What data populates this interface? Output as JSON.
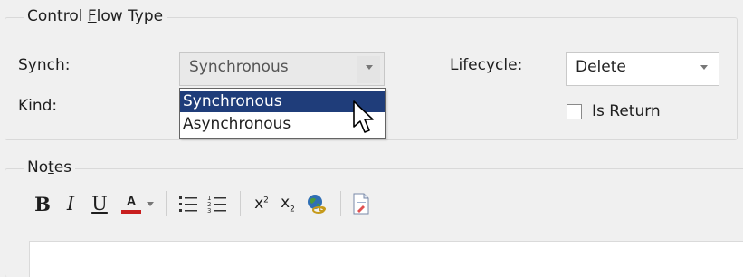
{
  "control_flow_group": {
    "legend_pre": "Control ",
    "legend_mnemonic": "F",
    "legend_post": "low Type",
    "synch_label": "Synch:",
    "synch_value": "Synchronous",
    "kind_label": "Kind:",
    "lifecycle_label": "Lifecycle:",
    "lifecycle_value": "Delete",
    "is_return_label": "Is Return",
    "synch_options": [
      "Synchronous",
      "Asynchronous"
    ],
    "synch_selected_index": 0
  },
  "notes_group": {
    "legend_pre": "No",
    "legend_mnemonic": "t",
    "legend_post": "es"
  },
  "toolbar": {
    "bold_icon": "B",
    "italic_icon": "I",
    "underline_icon": "U",
    "font_color_icon": "A",
    "superscript_base": "x",
    "superscript_exp": "2",
    "subscript_base": "x",
    "subscript_exp": "2"
  },
  "colors": {
    "selection": "#1f3d7a",
    "font_color_bar": "#c81e1e"
  }
}
